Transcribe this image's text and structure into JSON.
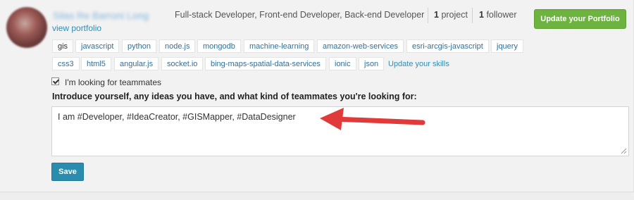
{
  "profile": {
    "name": "Silas Re Barroni Long",
    "view_portfolio": "view portfolio",
    "roles": "Full-stack Developer, Front-end Developer, Back-end Developer",
    "project_count": "1",
    "project_label": "project",
    "follower_count": "1",
    "follower_label": "follower",
    "update_portfolio_label": "Update your Portfolio"
  },
  "skills": {
    "tags": [
      "gis",
      "javascript",
      "python",
      "node.js",
      "mongodb",
      "machine-learning",
      "amazon-web-services",
      "esri-arcgis-javascript",
      "jquery",
      "css3",
      "html5",
      "angular.js",
      "socket.io",
      "bing-maps-spatial-data-services",
      "ionic",
      "json"
    ],
    "update_label": "Update your skills"
  },
  "teammates": {
    "looking_label": "I'm looking for teammates",
    "looking_checked": true,
    "intro_label": "Introduce yourself, any ideas you have, and what kind of teammates you're looking for:",
    "intro_value": "I am #Developer, #IdeaCreator, #GISMapper, #DataDesigner"
  },
  "save_label": "Save",
  "colors": {
    "accent_green": "#6db33f",
    "save_blue": "#2a8dad",
    "link_blue": "#2b8fb8",
    "arrow_red": "#e03a3a"
  }
}
